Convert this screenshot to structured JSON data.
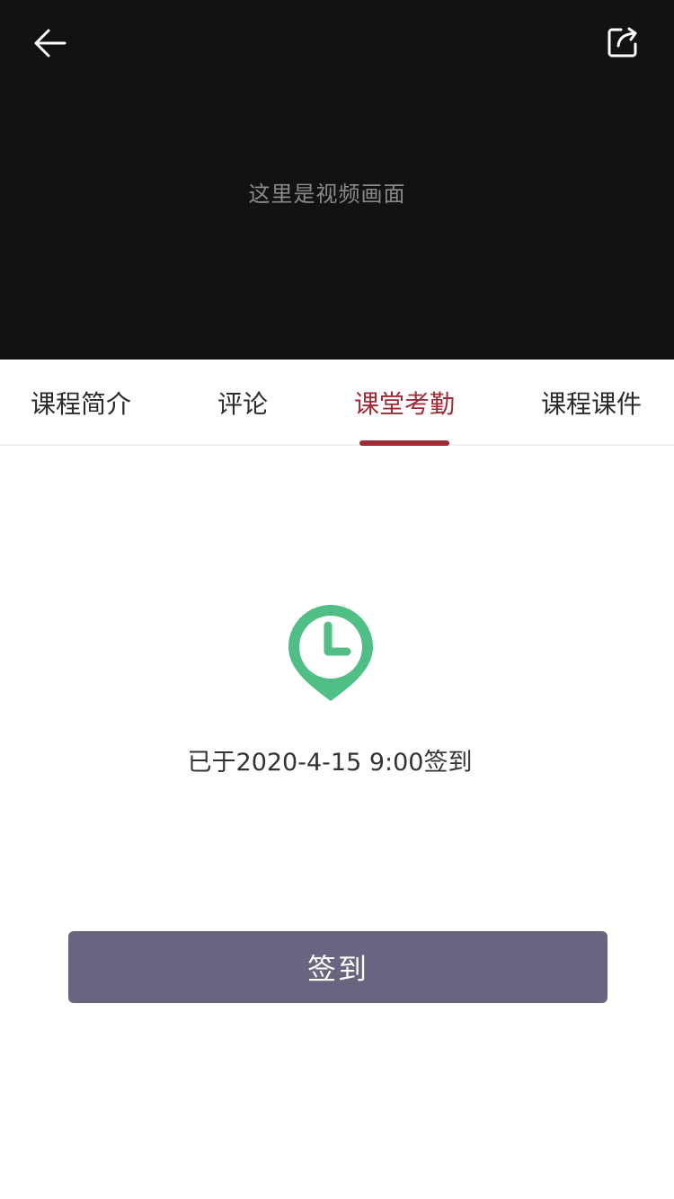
{
  "video": {
    "placeholder": "这里是视频画面",
    "back_icon": "arrow-left-icon",
    "share_icon": "share-icon"
  },
  "tabs": [
    {
      "label": "课程简介",
      "active": false
    },
    {
      "label": "评论",
      "active": false
    },
    {
      "label": "课堂考勤",
      "active": true
    },
    {
      "label": "课程课件",
      "active": false
    }
  ],
  "attendance": {
    "icon": "clock-pin-icon",
    "status_text": "已于2020-4-15 9:00签到",
    "button_label": "签到"
  },
  "colors": {
    "video_bg": "#121212",
    "accent": "#a02a36",
    "icon_green": "#4fbf86",
    "button_bg": "#6b6480"
  }
}
